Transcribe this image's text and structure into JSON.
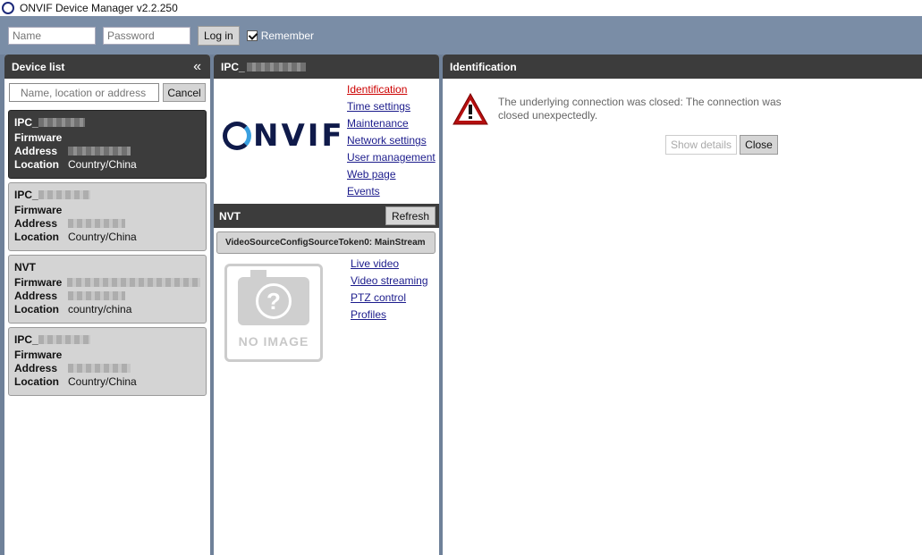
{
  "app": {
    "title": "ONVIF Device Manager v2.2.250"
  },
  "login": {
    "name_placeholder": "Name",
    "password_placeholder": "Password",
    "login_label": "Log in",
    "remember_label": "Remember",
    "remember_checked": true
  },
  "device_list": {
    "title": "Device list",
    "collapse_glyph": "«",
    "search_placeholder": "Name, location or address",
    "cancel_label": "Cancel",
    "devices": [
      {
        "name": "IPC_",
        "firmware_label": "Firmware",
        "address_label": "Address",
        "location_label": "Location",
        "location": "Country/China",
        "selected": true
      },
      {
        "name": "IPC_",
        "firmware_label": "Firmware",
        "address_label": "Address",
        "location_label": "Location",
        "location": "Country/China",
        "selected": false
      },
      {
        "name": "NVT",
        "firmware_label": "Firmware",
        "address_label": "Address",
        "location_label": "Location",
        "location": "country/china",
        "selected": false
      },
      {
        "name": "IPC_",
        "firmware_label": "Firmware",
        "address_label": "Address",
        "location_label": "Location",
        "location": "Country/China",
        "selected": false
      }
    ]
  },
  "device_panel": {
    "title": "IPC_",
    "logo_text": "NVIF",
    "links": [
      "Identification",
      "Time settings",
      "Maintenance",
      "Network settings",
      "User management",
      "Web page",
      "Events"
    ],
    "active_link": "Identification",
    "nvt_title": "NVT",
    "refresh_label": "Refresh",
    "stream_title": "VideoSourceConfigSourceToken0: MainStream",
    "noimage_text": "NO IMAGE",
    "stream_links": [
      "Live video",
      "Video streaming",
      "PTZ control",
      "Profiles"
    ]
  },
  "identification": {
    "title": "Identification",
    "error_message": "The underlying connection was closed: The connection was closed unexpectedly.",
    "show_details_label": "Show details",
    "close_label": "Close"
  }
}
